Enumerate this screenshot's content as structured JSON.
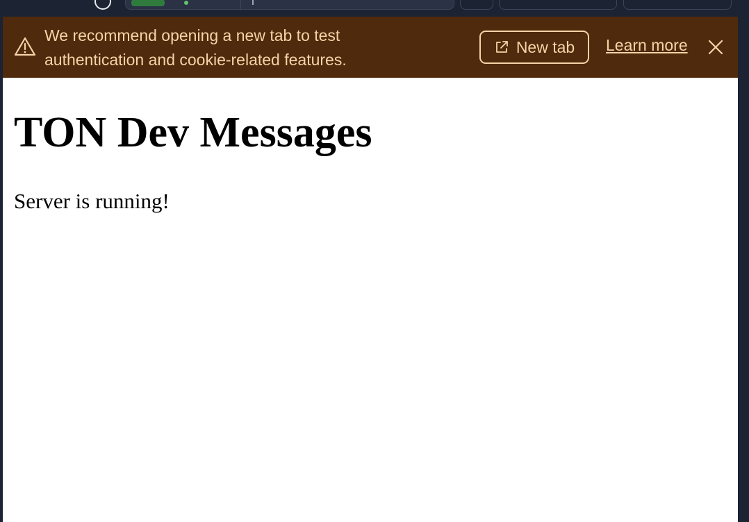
{
  "banner": {
    "message": "We recommend opening a new tab to test authentication and cookie-related features.",
    "new_tab_label": "New tab",
    "learn_more_label": "Learn more",
    "icon": "warning-icon",
    "background": "#4f2a0c",
    "text_color": "#f5d4a8"
  },
  "page": {
    "heading": "TON Dev Messages",
    "body": "Server is running!"
  }
}
